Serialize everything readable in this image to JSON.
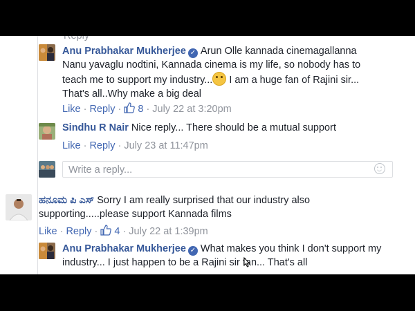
{
  "thread": {
    "clipped_top_actions": "Reply",
    "comments": [
      {
        "author": "Anu Prabhakar Mukherjee",
        "verified": true,
        "text_lines": [
          "Arun Olle kannada cinemagallanna",
          "Nanu yavaglu nodtini, Kannada cinema is my life, so nobody has to",
          "teach me to support my industry...",
          "I am a huge fan of Rajini sir...",
          "That's all..Why make a big deal"
        ],
        "like": "Like",
        "reply": "Reply",
        "likes_count": "8",
        "timestamp": "July 22 at 3:20pm"
      },
      {
        "author": "Sindhu R Nair",
        "text": "Nice reply... There should be a mutual support",
        "like": "Like",
        "reply": "Reply",
        "timestamp": "July 23 at 11:47pm"
      },
      {
        "author": "ಹನೂಮ ಪಿ ಎಸ್",
        "text_lines": [
          "Sorry I am really surprised that our industry also",
          "supporting.....please support Kannada films"
        ],
        "like": "Like",
        "reply": "Reply",
        "likes_count": "4",
        "timestamp": "July 22 at 1:39pm"
      },
      {
        "author": "Anu Prabhakar Mukherjee",
        "verified": true,
        "text_lines": [
          "What makes you think I don't support my",
          "industry... I just happen to be a Rajini sir fan... That's all"
        ]
      }
    ],
    "reply_box": {
      "placeholder": "Write a reply..."
    }
  },
  "colors": {
    "author": "#365899",
    "link": "#4267b2",
    "meta": "#90949c",
    "text": "#1d2129",
    "border": "#dddfe2"
  },
  "icons": [
    "verified-badge-icon",
    "thumbs-up-icon",
    "smiley-emoji-icon",
    "emoji-picker-icon",
    "mouse-cursor-icon"
  ]
}
